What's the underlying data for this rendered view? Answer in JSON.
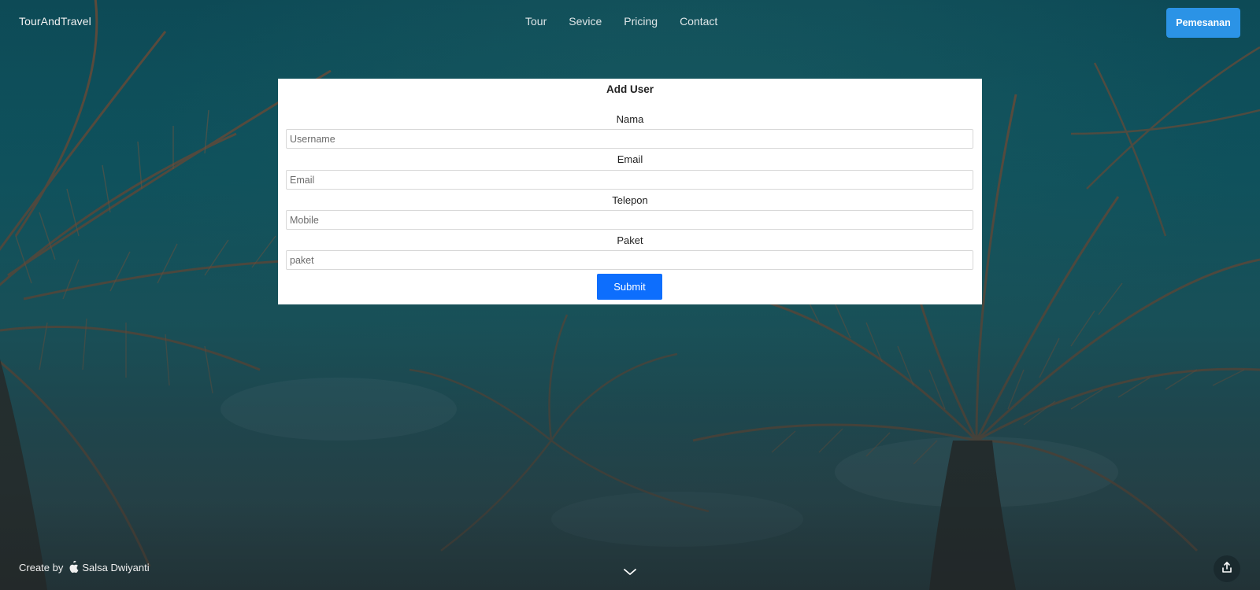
{
  "navbar": {
    "brand": "TourAndTravel",
    "links": [
      {
        "label": "Tour"
      },
      {
        "label": "Sevice"
      },
      {
        "label": "Pricing"
      },
      {
        "label": "Contact"
      }
    ],
    "cta_label": "Pemesanan",
    "cta_color": "#2b93e6"
  },
  "form": {
    "title": "Add User",
    "fields": [
      {
        "label": "Nama",
        "placeholder": "Username"
      },
      {
        "label": "Email",
        "placeholder": "Email"
      },
      {
        "label": "Telepon",
        "placeholder": "Mobile"
      },
      {
        "label": "Paket",
        "placeholder": "paket"
      }
    ],
    "submit_label": "Submit",
    "submit_color": "#0d6efd"
  },
  "footer": {
    "credit_prefix": "Create by",
    "credit_icon": "apple-icon",
    "credit_name": "Salsa Dwiyanti",
    "scroll_icon": "chevron-down-icon",
    "share_icon": "share-icon"
  }
}
